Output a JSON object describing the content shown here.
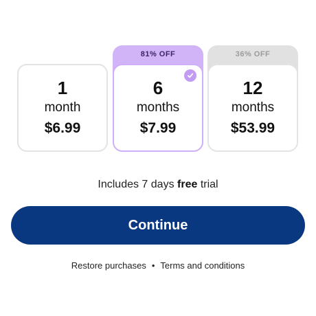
{
  "plans": [
    {
      "duration": "1",
      "unit": "month",
      "price": "$6.99",
      "badge": "",
      "selected": false
    },
    {
      "duration": "6",
      "unit": "months",
      "price": "$7.99",
      "badge": "81% OFF",
      "selected": true,
      "check_icon": "checkmark-icon"
    },
    {
      "duration": "12",
      "unit": "months",
      "price": "$53.99",
      "badge": "36% OFF",
      "selected": false
    }
  ],
  "trial": {
    "prefix": "Includes 7 days ",
    "emphasis": "free",
    "suffix": " trial"
  },
  "continue_label": "Continue",
  "footer": {
    "restore_label": "Restore purchases",
    "separator": "•",
    "terms_label": "Terms and conditions"
  },
  "colors": {
    "primary_button": "#0a3880",
    "selected_accent": "#c29bf3",
    "selected_badge": "#d1b3f7",
    "muted_badge": "#e1e1e1"
  }
}
